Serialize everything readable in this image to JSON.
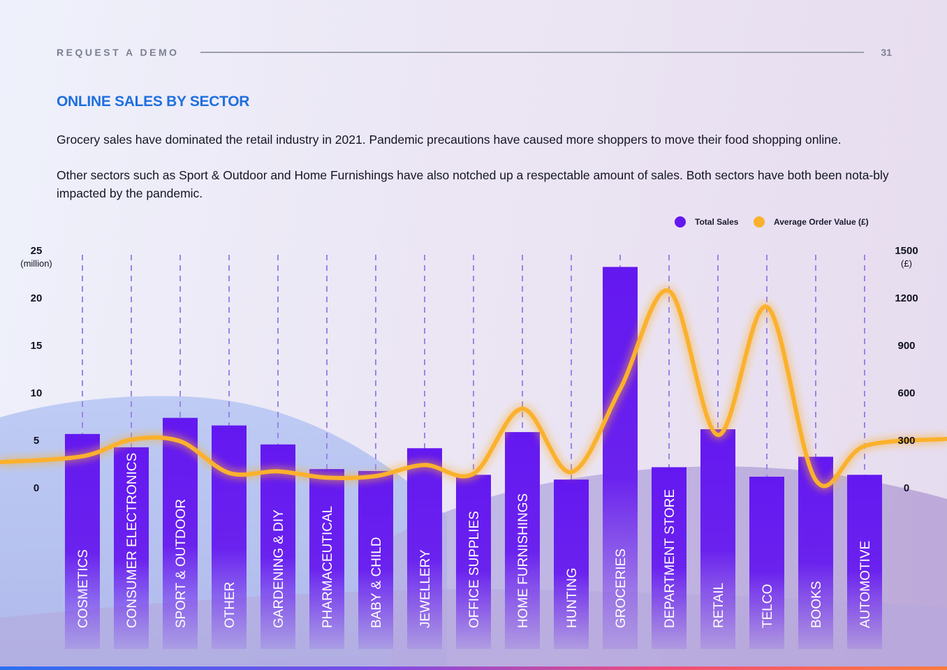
{
  "header": {
    "kicker": "REQUEST A DEMO",
    "page_number": "31"
  },
  "title": "ONLINE SALES BY SECTOR",
  "paragraphs": [
    "Grocery sales have dominated the retail industry in 2021. Pandemic precautions have caused more shoppers to move their food shopping online.",
    "Other sectors such as Sport & Outdoor and Home Furnishings have also notched up a respectable amount of sales. Both sectors have both been nota-bly impacted by the pandemic."
  ],
  "colors": {
    "accent_title": "#1f6fe0",
    "bar": "#6418f0",
    "line": "#fbb12d",
    "gridline": "#9b84e8"
  },
  "chart_data": {
    "type": "bar",
    "title": "",
    "categories": [
      "COSMETICS",
      "CONSUMER ELECTRONICS",
      "SPORT & OUTDOOR",
      "OTHER",
      "GARDENING & DIY",
      "PHARMACEUTICAL",
      "BABY & CHILD",
      "JEWELLERY",
      "OFFICE SUPPLIES",
      "HOME FURNISHINGS",
      "HUNTING",
      "GROCERIES",
      "DEPARTMENT STORE",
      "RETAIL",
      "TELCO",
      "BOOKS",
      "AUTOMOTIVE"
    ],
    "series": [
      {
        "name": "Total Sales",
        "type": "bar",
        "axis": "left",
        "values": [
          5.6,
          4.2,
          7.3,
          6.5,
          4.5,
          1.9,
          1.7,
          4.1,
          1.3,
          5.8,
          0.8,
          23.2,
          2.1,
          6.1,
          1.1,
          3.2,
          1.3
        ]
      },
      {
        "name": "Average Order Value (£)",
        "type": "line",
        "axis": "right",
        "values": [
          195,
          300,
          290,
          90,
          100,
          60,
          70,
          140,
          85,
          495,
          95,
          620,
          1240,
          330,
          1140,
          45,
          260
        ]
      }
    ],
    "y_left": {
      "ticks": [
        "0",
        "5",
        "10",
        "15",
        "20",
        "25"
      ],
      "unit": "(million)",
      "range": [
        0,
        25
      ]
    },
    "y_right": {
      "ticks": [
        "0",
        "300",
        "600",
        "900",
        "1200",
        "1500"
      ],
      "unit": "(£)",
      "range": [
        0,
        1500
      ]
    },
    "legend_position": "top-right",
    "vertical_dashed_gridlines": true
  }
}
